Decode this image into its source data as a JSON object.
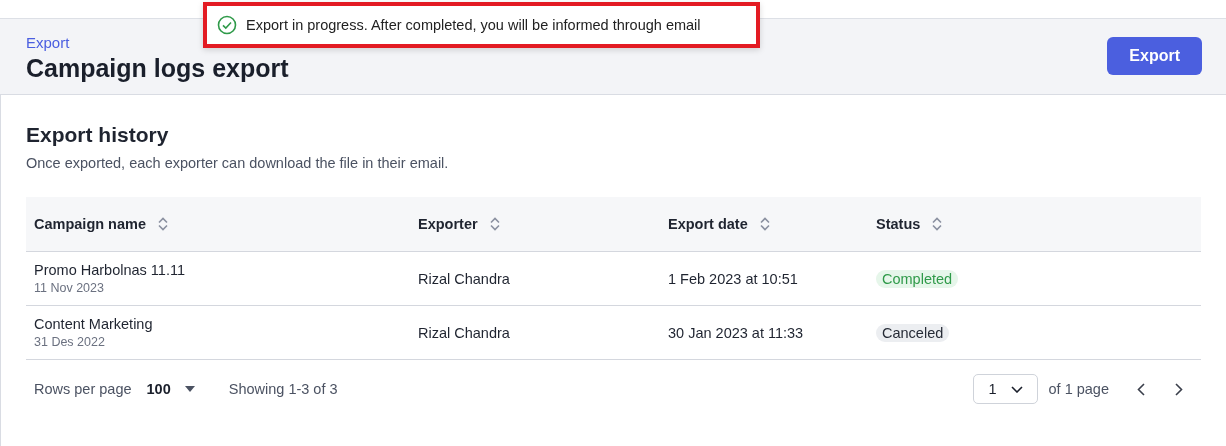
{
  "toast": {
    "message": "Export in progress. After completed, you will be informed through email"
  },
  "header": {
    "breadcrumb": "Export",
    "title": "Campaign logs export",
    "button": "Export"
  },
  "section": {
    "title": "Export history",
    "description": "Once exported, each exporter can download the file in their email."
  },
  "table": {
    "columns": [
      "Campaign name",
      "Exporter",
      "Export date",
      "Status"
    ],
    "rows": [
      {
        "name": "Promo Harbolnas 11.11",
        "date": "11 Nov 2023",
        "exporter": "Rizal Chandra",
        "export_date": "1 Feb 2023 at 10:51",
        "status": {
          "label": "Completed",
          "kind": "success"
        }
      },
      {
        "name": "Content Marketing",
        "date": "31 Des 2022",
        "exporter": "Rizal Chandra",
        "export_date": "30 Jan 2023 at 11:33",
        "status": {
          "label": "Canceled",
          "kind": "neutral"
        }
      }
    ]
  },
  "pagination": {
    "rows_label": "Rows per page",
    "rows_value": "100",
    "showing": "Showing 1-3 of 3",
    "page": "1",
    "of_pages": "of 1 page"
  }
}
